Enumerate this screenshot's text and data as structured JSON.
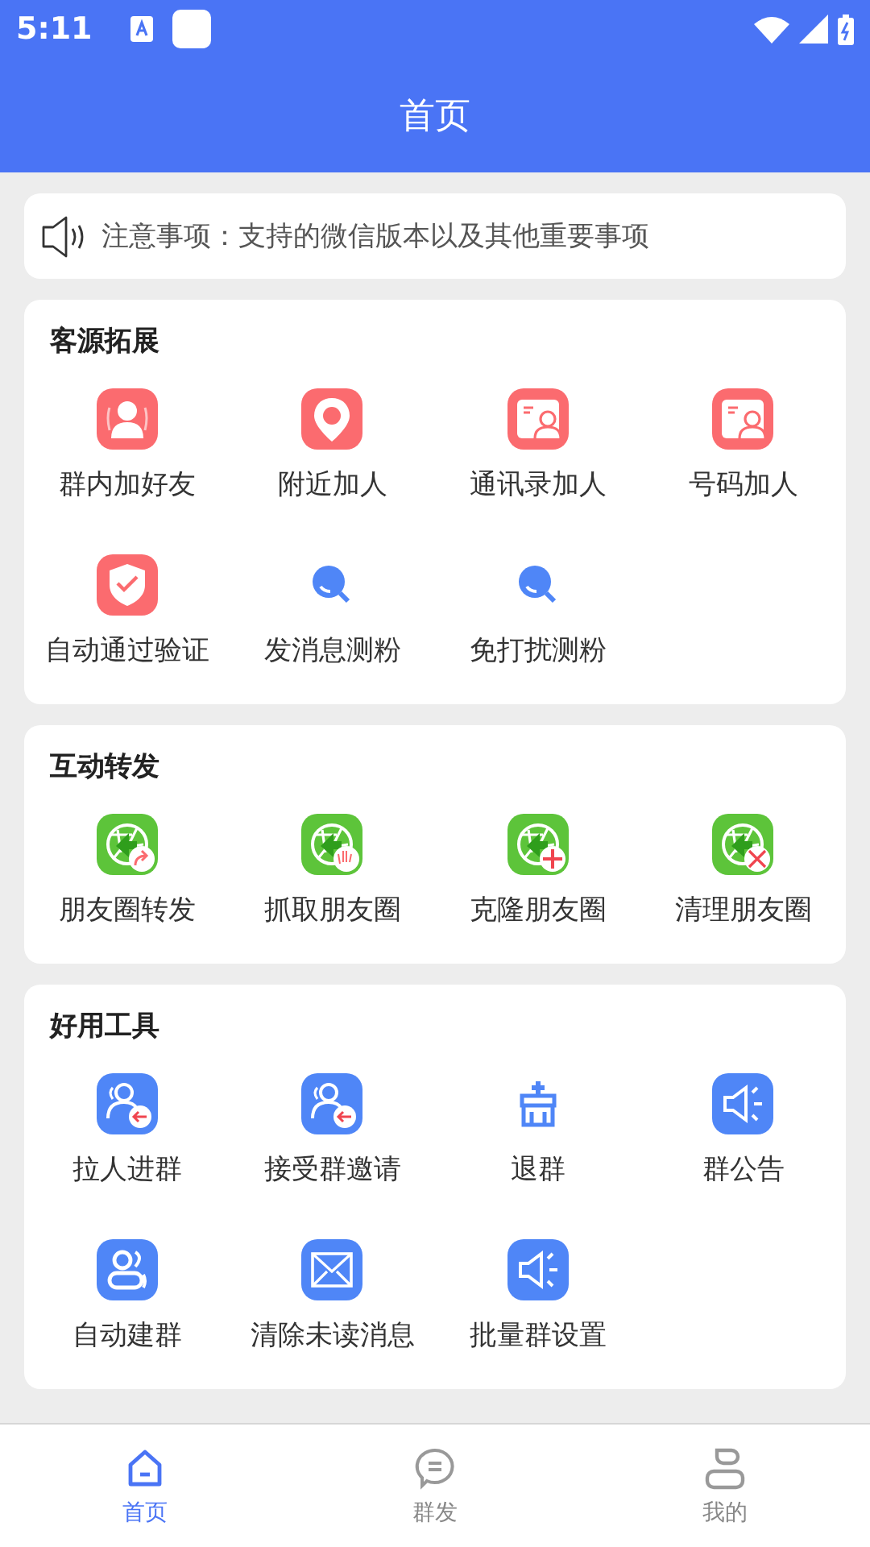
{
  "status_bar": {
    "time": "5:11"
  },
  "header": {
    "title": "首页"
  },
  "notice": {
    "text": "注意事项：支持的微信版本以及其他重要事项"
  },
  "sections": [
    {
      "title": "客源拓展",
      "items": [
        {
          "label": "群内加好友"
        },
        {
          "label": "附近加人"
        },
        {
          "label": "通讯录加人"
        },
        {
          "label": "号码加人"
        },
        {
          "label": "自动通过验证"
        },
        {
          "label": "发消息测粉"
        },
        {
          "label": "免打扰测粉"
        }
      ]
    },
    {
      "title": "互动转发",
      "items": [
        {
          "label": "朋友圈转发"
        },
        {
          "label": "抓取朋友圈"
        },
        {
          "label": "克隆朋友圈"
        },
        {
          "label": "清理朋友圈"
        }
      ]
    },
    {
      "title": "好用工具",
      "items": [
        {
          "label": "拉人进群"
        },
        {
          "label": "接受群邀请"
        },
        {
          "label": "退群"
        },
        {
          "label": "群公告"
        },
        {
          "label": "自动建群"
        },
        {
          "label": "清除未读消息"
        },
        {
          "label": "批量群设置"
        }
      ]
    }
  ],
  "bottom_nav": [
    {
      "label": "首页",
      "selected": true
    },
    {
      "label": "群发",
      "selected": false
    },
    {
      "label": "我的",
      "selected": false
    }
  ]
}
